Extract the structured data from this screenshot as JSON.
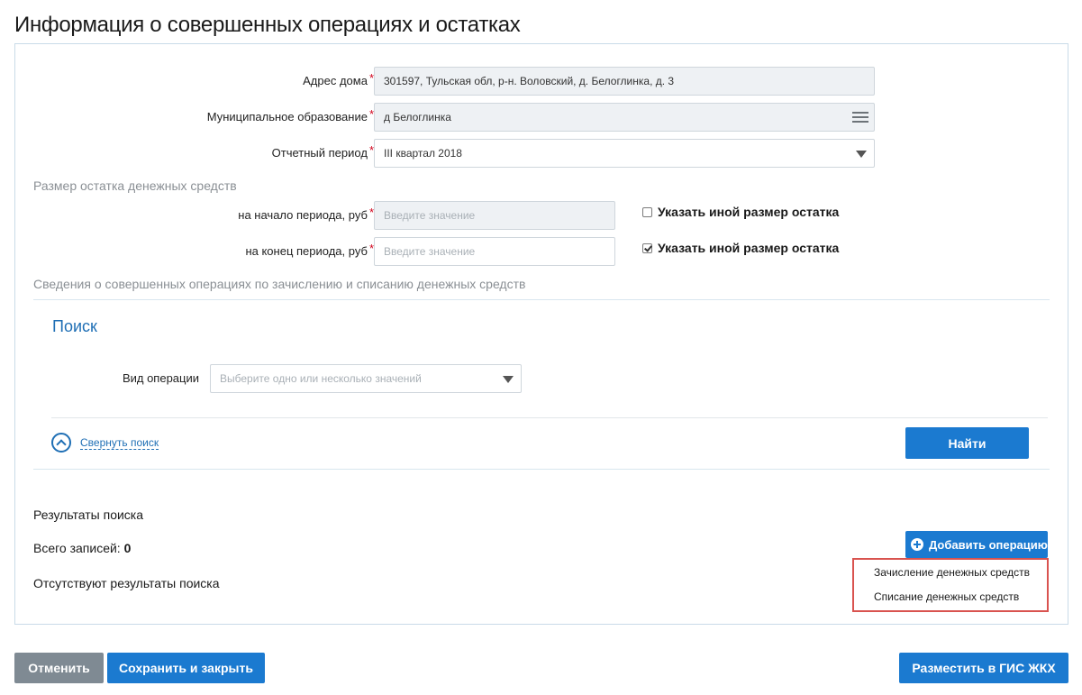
{
  "page": {
    "title": "Информация о совершенных операциях и остатках"
  },
  "form": {
    "address": {
      "label": "Адрес дома",
      "value": "301597, Тульская обл, р-н. Воловский, д. Белоглинка, д. 3"
    },
    "municipality": {
      "label": "Муниципальное образование",
      "value": "д Белоглинка"
    },
    "period": {
      "label": "Отчетный период",
      "value": "III квартал 2018"
    },
    "required_mark": "*"
  },
  "balance": {
    "section_title": "Размер остатка денежных средств",
    "start": {
      "label": "на начало периода, руб",
      "placeholder": "Введите значение",
      "checkbox_label": "Указать иной размер остатка",
      "checked": false
    },
    "end": {
      "label": "на конец периода, руб",
      "placeholder": "Введите значение",
      "checkbox_label": "Указать иной размер остатка",
      "checked": true
    }
  },
  "operations": {
    "section_title": "Сведения о совершенных операциях по зачислению и списанию денежных средств"
  },
  "search": {
    "title": "Поиск",
    "operation_type": {
      "label": "Вид операции",
      "placeholder": "Выберите одно или несколько значений"
    },
    "collapse_label": "Свернуть поиск",
    "find_button": "Найти"
  },
  "results": {
    "title": "Результаты поиска",
    "total_label": "Всего записей:",
    "total_value": "0",
    "empty_message": "Отсутствуют результаты поиска",
    "add_button": "Добавить операцию",
    "add_menu": [
      "Зачисление денежных средств",
      "Списание денежных средств"
    ]
  },
  "footer": {
    "cancel": "Отменить",
    "save_close": "Сохранить и закрыть",
    "publish": "Разместить в ГИС ЖКХ"
  },
  "colors": {
    "accent": "#1b7ad0",
    "link": "#1f6fb5",
    "highlight": "#d9534f",
    "grey_button": "#7f8a93"
  },
  "icons": {
    "menu": "hamburger-icon",
    "caret": "caret-down-icon",
    "collapse": "chevron-up-circle-icon",
    "add": "plus-circle-icon"
  }
}
